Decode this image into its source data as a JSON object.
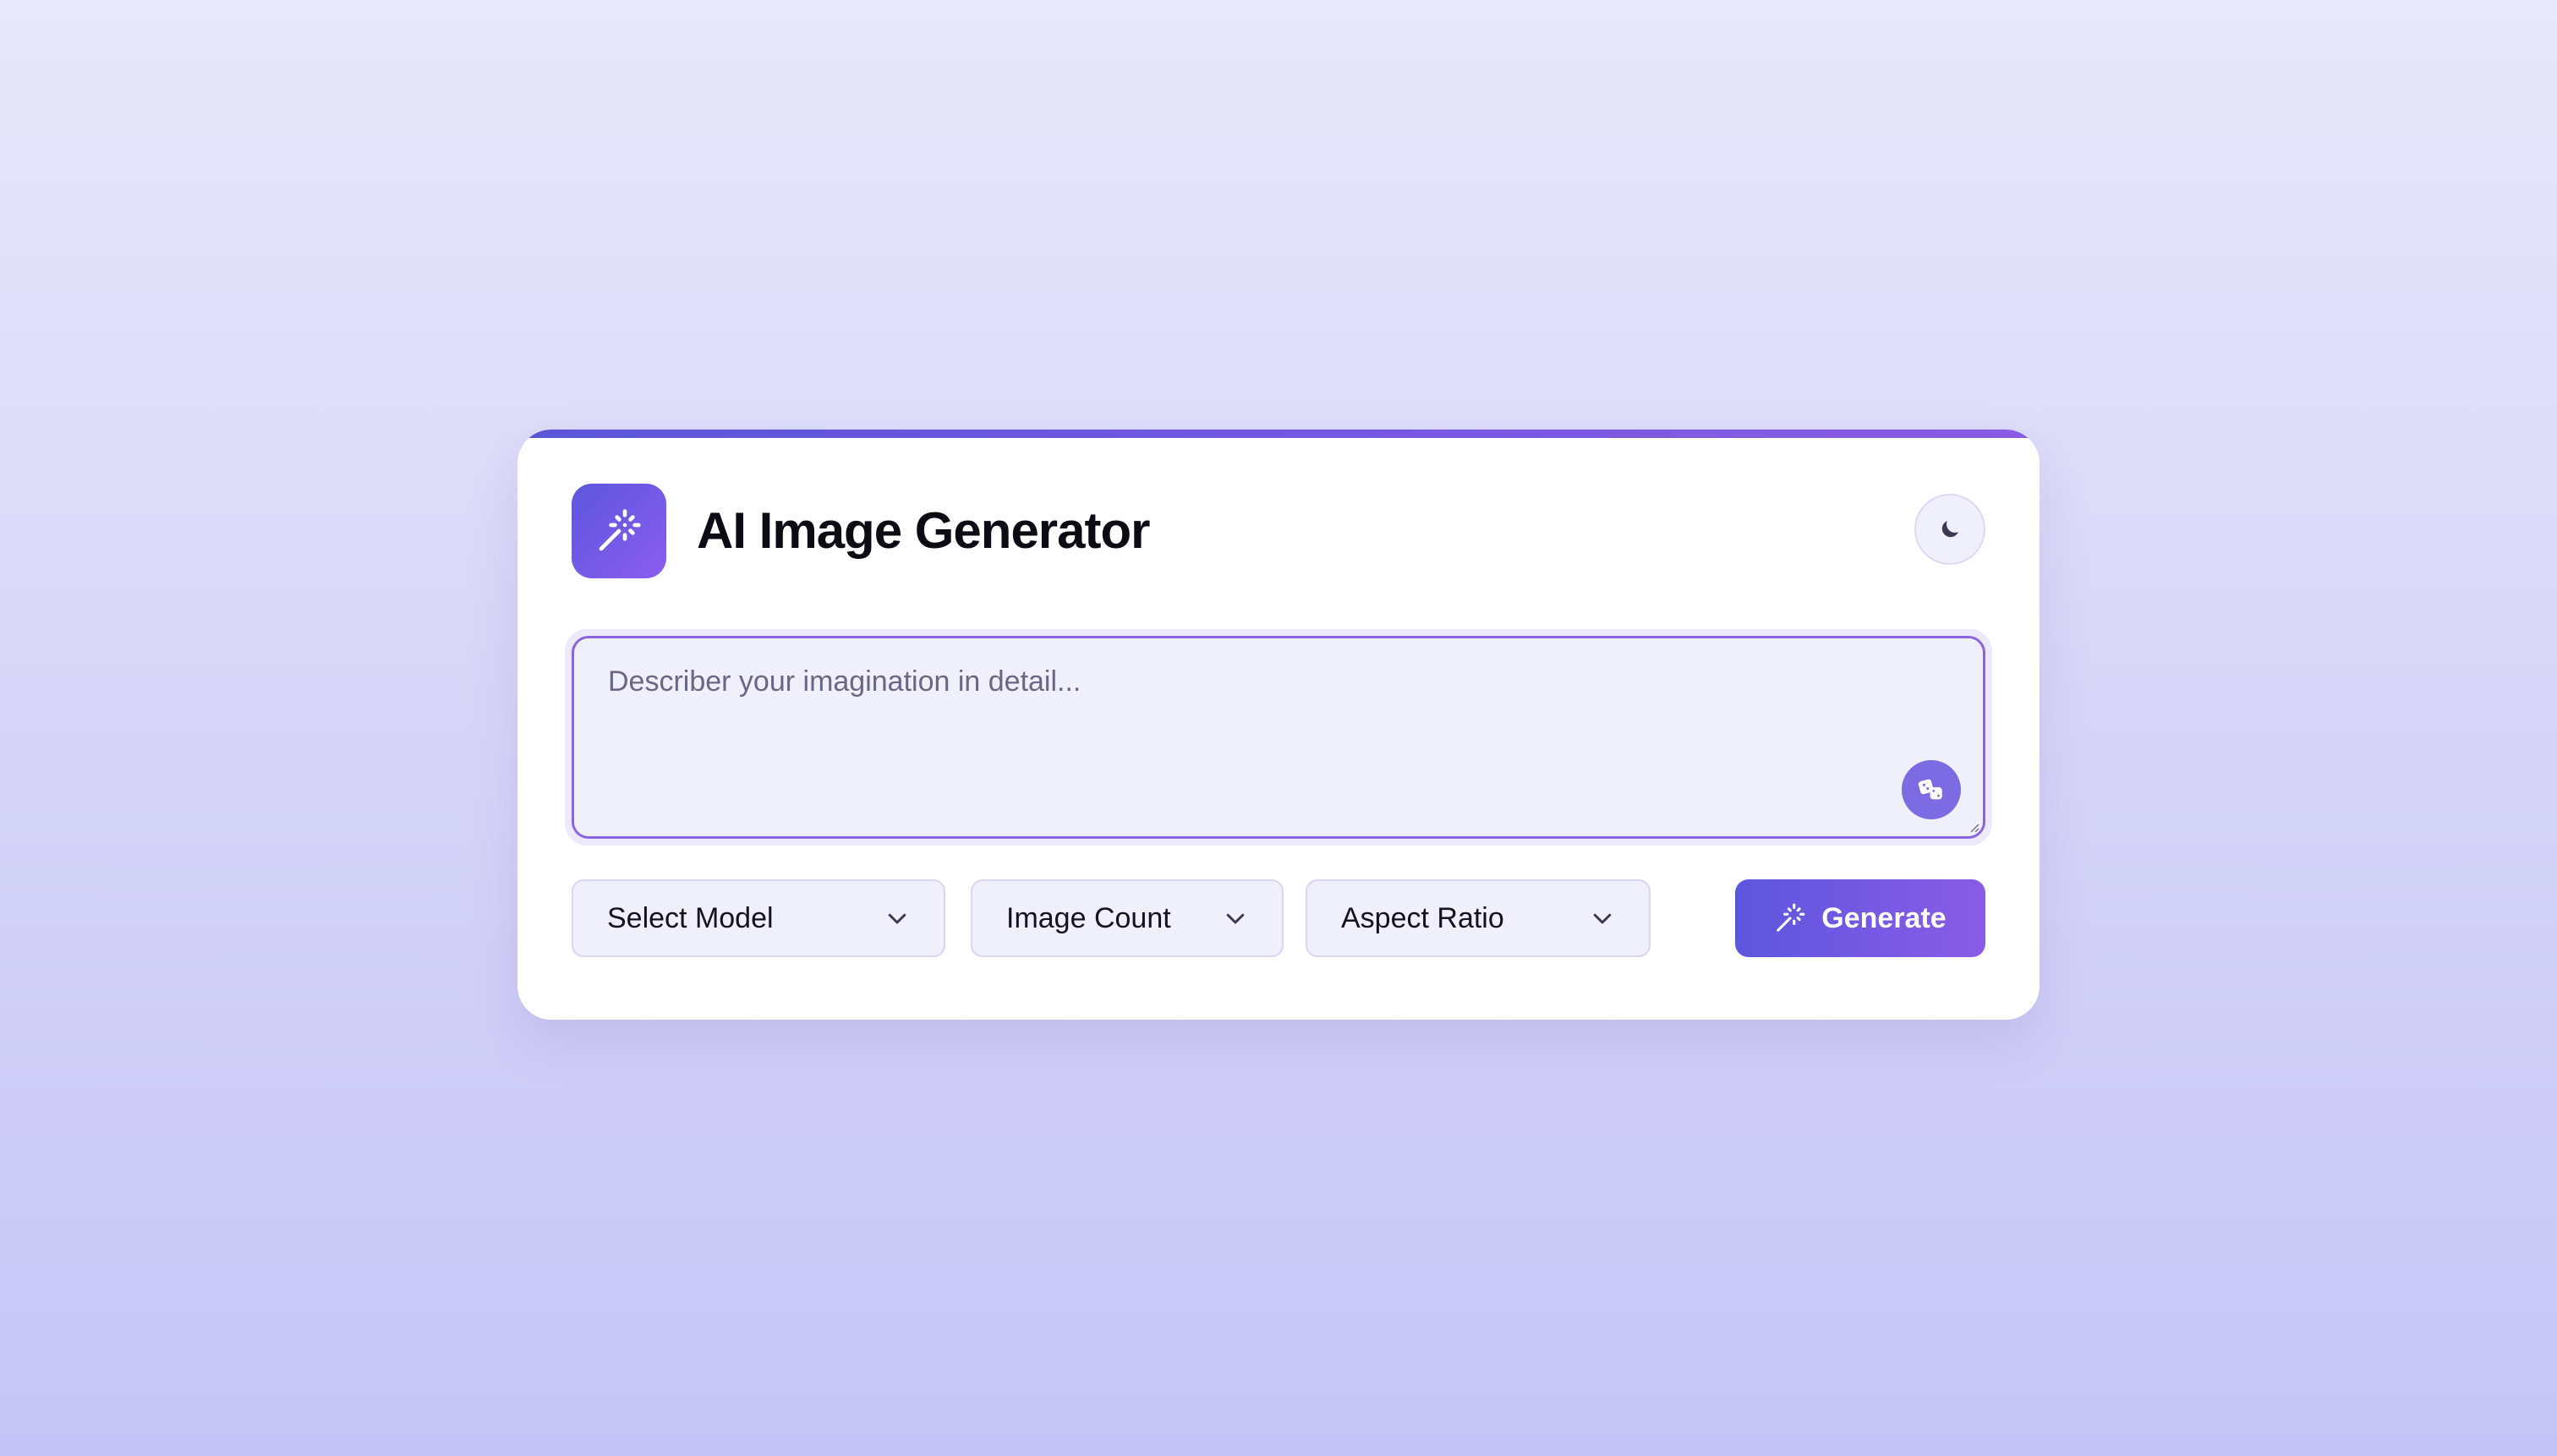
{
  "app": {
    "title": "AI Image Generator"
  },
  "prompt": {
    "value": "",
    "placeholder": "Describer your imagination in detail..."
  },
  "controls": {
    "model_label": "Select Model",
    "count_label": "Image Count",
    "ratio_label": "Aspect Ratio",
    "generate_label": "Generate"
  },
  "icons": {
    "logo": "magic-wand-icon",
    "theme": "moon-icon",
    "random": "dice-icon",
    "dropdown": "chevron-down-icon",
    "generate": "magic-wand-icon"
  },
  "colors": {
    "accent": "#5d56de",
    "accent_end": "#8a5be6",
    "field_bg": "#f0effc",
    "focus_border": "#8b66e0"
  }
}
